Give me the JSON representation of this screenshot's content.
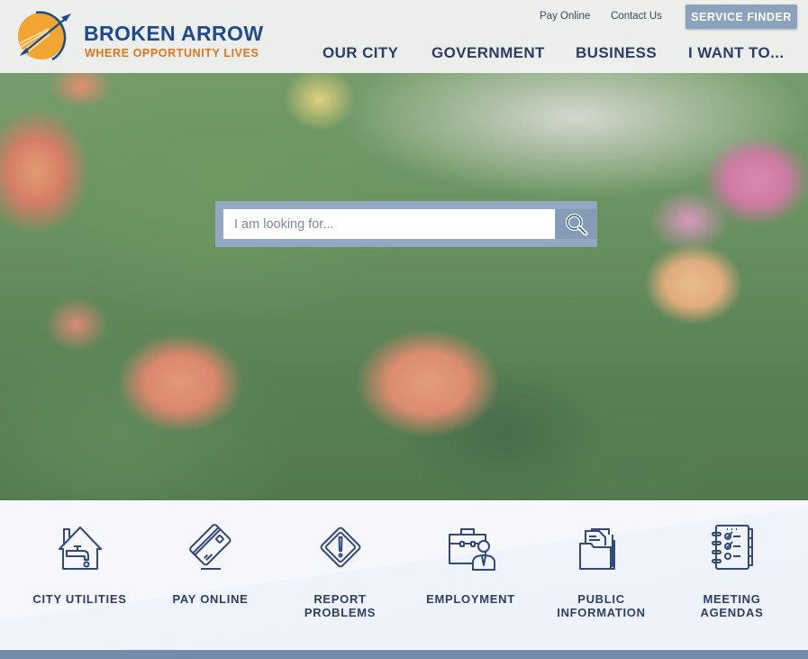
{
  "site": {
    "name": "BROKEN ARROW",
    "tagline": "WHERE OPPORTUNITY LIVES"
  },
  "utility_links": {
    "pay_online": "Pay Online",
    "contact_us": "Contact Us",
    "service_finder": "SERVICE FINDER"
  },
  "nav": {
    "items": [
      {
        "label": "OUR CITY"
      },
      {
        "label": "GOVERNMENT"
      },
      {
        "label": "BUSINESS"
      },
      {
        "label": "I WANT TO..."
      }
    ]
  },
  "search": {
    "placeholder": "I am looking for...",
    "value": "",
    "icon": "search-icon"
  },
  "quick_links": [
    {
      "label": "CITY UTILITIES",
      "icon": "house-faucet-icon"
    },
    {
      "label": "PAY ONLINE",
      "icon": "credit-card-icon"
    },
    {
      "label": "REPORT\nPROBLEMS",
      "icon": "warning-sign-icon"
    },
    {
      "label": "EMPLOYMENT",
      "icon": "briefcase-person-icon"
    },
    {
      "label": "PUBLIC\nINFORMATION",
      "icon": "folder-documents-icon"
    },
    {
      "label": "MEETING\nAGENDAS",
      "icon": "checklist-notebook-icon"
    }
  ],
  "colors": {
    "brand_blue": "#1f4a8c",
    "brand_orange": "#e1741c",
    "nav_text": "#2c3e63",
    "search_frame": "#93a8c0",
    "service_finder_bg": "#8aa2bc",
    "quick_link_text": "#2e3f66",
    "footer_bar": "#728ba8"
  }
}
